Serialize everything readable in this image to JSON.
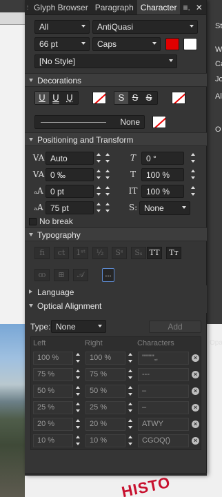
{
  "tabs": {
    "glyph": "Glyph Browser",
    "paragraph": "Paragraph",
    "character": "Character"
  },
  "font": {
    "family_group": "All",
    "family": "AntiQuasi",
    "size": "66 pt",
    "caps": "Caps",
    "style": "[No Style]"
  },
  "colors": {
    "fill": "#e00000",
    "second": "#ffffff"
  },
  "decorations": {
    "title": "Decorations",
    "line_label": "None"
  },
  "positioning": {
    "title": "Positioning and Transform",
    "leading": "Auto",
    "tracking": "0 ‰",
    "baseline": "0 pt",
    "kerning": "75 pt",
    "skew": "0 °",
    "hscale": "100 %",
    "vscale": "100 %",
    "shear": "None"
  },
  "no_break": "No break",
  "typography": {
    "title": "Typography"
  },
  "language": {
    "title": "Language"
  },
  "optical": {
    "title": "Optical Alignment",
    "type_label": "Type:",
    "type_value": "None",
    "add_label": "Add",
    "headers": [
      "Left",
      "Right",
      "Characters"
    ],
    "rows": [
      {
        "left": "100 %",
        "right": "100 %",
        "chars": "'\"\"\"\"‚,"
      },
      {
        "left": "75 %",
        "right": "75 %",
        "chars": "---"
      },
      {
        "left": "50 %",
        "right": "50 %",
        "chars": "–"
      },
      {
        "left": "25 %",
        "right": "25 %",
        "chars": "–"
      },
      {
        "left": "20 %",
        "right": "20 %",
        "chars": "ATWY"
      },
      {
        "left": "10 %",
        "right": "10 %",
        "chars": "CGOQ()"
      }
    ]
  },
  "background": {
    "right_labels": [
      "St",
      "W",
      "Ca",
      "Jo",
      "Al",
      "O",
      "Opa"
    ],
    "stamp": "HISTO"
  }
}
